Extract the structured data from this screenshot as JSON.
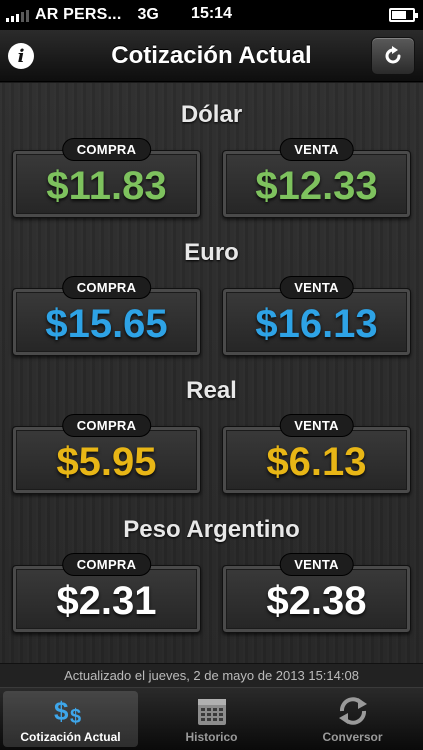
{
  "status_bar": {
    "carrier": "AR PERS...",
    "network": "3G",
    "time": "15:14",
    "battery_level": 0.7
  },
  "nav": {
    "title": "Cotización Actual"
  },
  "currencies": [
    {
      "name": "Dólar",
      "buy_label": "COMPRA",
      "buy": "$11.83",
      "sell_label": "VENTA",
      "sell": "$12.33",
      "color": "#7ec25e"
    },
    {
      "name": "Euro",
      "buy_label": "COMPRA",
      "buy": "$15.65",
      "sell_label": "VENTA",
      "sell": "$16.13",
      "color": "#2ea3e6"
    },
    {
      "name": "Real",
      "buy_label": "COMPRA",
      "buy": "$5.95",
      "sell_label": "VENTA",
      "sell": "$6.13",
      "color": "#e8b616"
    },
    {
      "name": "Peso Argentino",
      "buy_label": "COMPRA",
      "buy": "$2.31",
      "sell_label": "VENTA",
      "sell": "$2.38",
      "color": "#ffffff"
    }
  ],
  "updated_text": "Actualizado el jueves, 2 de mayo de 2013 15:14:08",
  "tabs": [
    {
      "label": "Cotización Actual",
      "icon": "dollar-icon",
      "active": true
    },
    {
      "label": "Historico",
      "icon": "calendar-icon",
      "active": false
    },
    {
      "label": "Conversor",
      "icon": "sync-icon",
      "active": false
    }
  ]
}
